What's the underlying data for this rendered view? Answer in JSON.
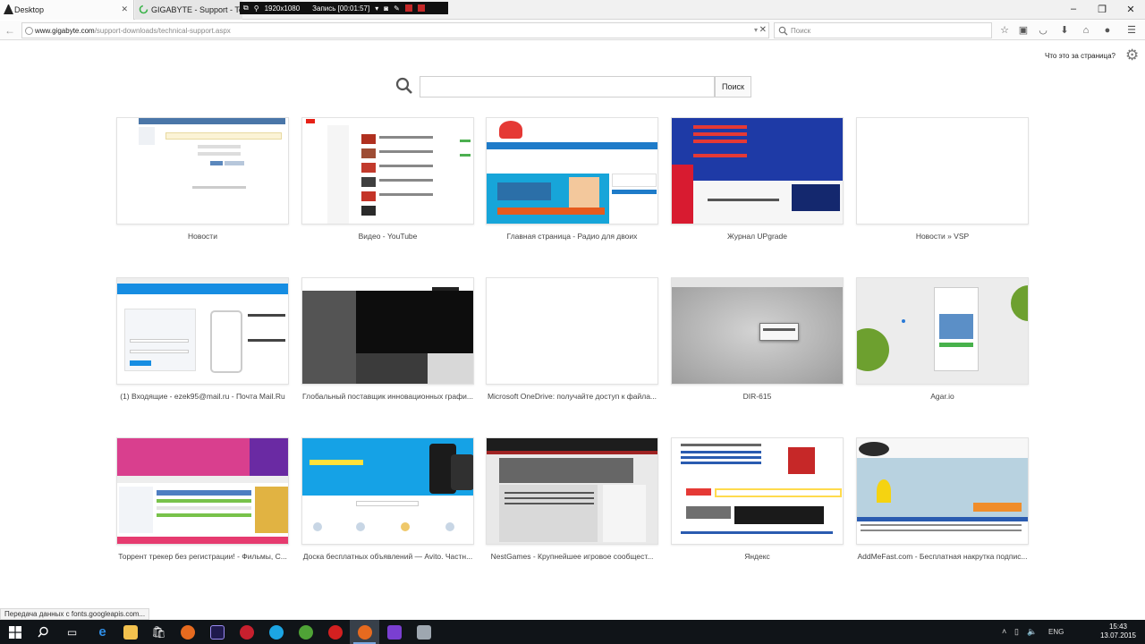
{
  "tabs": [
    {
      "label": "Desktop"
    },
    {
      "label": "GIGABYTE - Support - Tec..."
    }
  ],
  "recorder": {
    "resolution": "1920x1080",
    "status": "Запись [00:01:57]"
  },
  "url": {
    "host": "www.gigabyte.com",
    "path": "/support-downloads/technical-support.aspx"
  },
  "search_placeholder": "Поиск",
  "page_help": "Что это за страница?",
  "main_search_button": "Поиск",
  "tiles": [
    {
      "label": "Новости"
    },
    {
      "label": "Видео - YouTube"
    },
    {
      "label": "Главная страница - Радио для двоих"
    },
    {
      "label": "Журнал UPgrade"
    },
    {
      "label": "Новости » VSP"
    },
    {
      "label": "(1) Входящие - ezek95@mail.ru - Почта Mail.Ru"
    },
    {
      "label": "Глобальный поставщик инновационных графи..."
    },
    {
      "label": "Microsoft OneDrive: получайте доступ к файла..."
    },
    {
      "label": "DIR-615"
    },
    {
      "label": "Agar.io"
    },
    {
      "label": "Торрент трекер без регистрации! - Фильмы, С..."
    },
    {
      "label": "Доска бесплатных объявлений — Avito. Частн..."
    },
    {
      "label": "NestGames - Крупнейшее игровое сообщест..."
    },
    {
      "label": "Яндекс"
    },
    {
      "label": "AddMeFast.com - Бесплатная накрутка подпис..."
    }
  ],
  "status_text": "Передача данных с fonts.googleapis.com...",
  "tray": {
    "lang": "ENG",
    "time": "15:43",
    "date": "13.07.2015"
  },
  "colors": {
    "accent_blue": "#2a7ad6",
    "tab_bg": "#f1f1f1",
    "taskbar": "#101418"
  }
}
